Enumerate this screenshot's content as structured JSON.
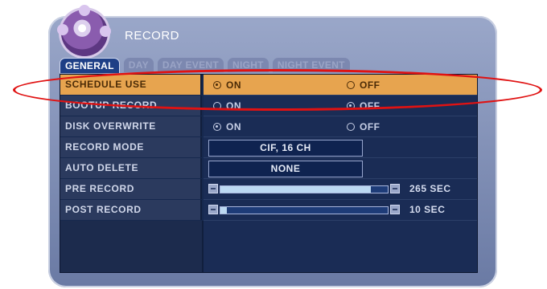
{
  "window": {
    "title": "RECORD"
  },
  "tabs": [
    {
      "label": "GENERAL",
      "active": true
    },
    {
      "label": "DAY",
      "active": false
    },
    {
      "label": "DAY EVENT",
      "active": false
    },
    {
      "label": "NIGHT",
      "active": false
    },
    {
      "label": "NIGHT EVENT",
      "active": false
    }
  ],
  "rows": {
    "schedule_use": {
      "label": "SCHEDULE USE",
      "on": "ON",
      "off": "OFF",
      "selected": "ON"
    },
    "bootup_record": {
      "label": "BOOTUP RECORD",
      "on": "ON",
      "off": "OFF",
      "selected": "OFF"
    },
    "disk_overwrite": {
      "label": "DISK OVERWRITE",
      "on": "ON",
      "off": "OFF",
      "selected": "ON"
    },
    "record_mode": {
      "label": "RECORD MODE",
      "value": "CIF, 16 CH"
    },
    "auto_delete": {
      "label": "AUTO DELETE",
      "value": "NONE"
    },
    "pre_record": {
      "label": "PRE RECORD",
      "value": "265 SEC",
      "level": 0.9
    },
    "post_record": {
      "label": "POST RECORD",
      "value": "10 SEC",
      "level": 0.04
    }
  },
  "colors": {
    "highlight": "#e7a44f",
    "annotation": "#e01212",
    "panel": "#16284e"
  }
}
